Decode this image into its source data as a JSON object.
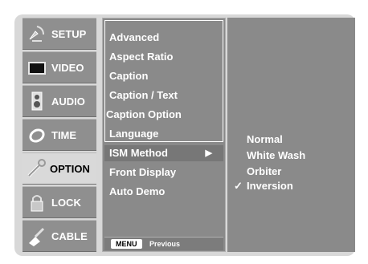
{
  "tabs": [
    {
      "label": "SETUP",
      "icon": "satellite-dish-icon"
    },
    {
      "label": "VIDEO",
      "icon": "tv-screen-icon"
    },
    {
      "label": "AUDIO",
      "icon": "speaker-icon"
    },
    {
      "label": "TIME",
      "icon": "clock-icon"
    },
    {
      "label": "OPTION",
      "icon": "wrench-icon"
    },
    {
      "label": "LOCK",
      "icon": "padlock-icon"
    },
    {
      "label": "CABLE",
      "icon": "cable-plug-icon"
    }
  ],
  "active_tab": "OPTION",
  "menu": {
    "items": [
      {
        "label": "Advanced"
      },
      {
        "label": "Aspect Ratio"
      },
      {
        "label": "Caption"
      },
      {
        "label": "Caption / Text"
      },
      {
        "label": "Caption Option"
      },
      {
        "label": "Language"
      },
      {
        "label": "ISM Method",
        "arrow": "▶"
      },
      {
        "label": "Front Display"
      },
      {
        "label": "Auto Demo"
      }
    ],
    "selected": "ISM Method"
  },
  "submenu": {
    "options": [
      {
        "label": "Normal"
      },
      {
        "label": "White Wash"
      },
      {
        "label": "Orbiter"
      },
      {
        "label": "Inversion",
        "check": "✓"
      }
    ],
    "selected": "Inversion"
  },
  "footer": {
    "button": "MENU",
    "label": "Previous"
  },
  "colors": {
    "frame": "#d8d8d8",
    "panel": "#8a8a8a",
    "tab": "#8f8f8f",
    "tab_active": "#d9d9d9",
    "text": "#ffffff"
  }
}
